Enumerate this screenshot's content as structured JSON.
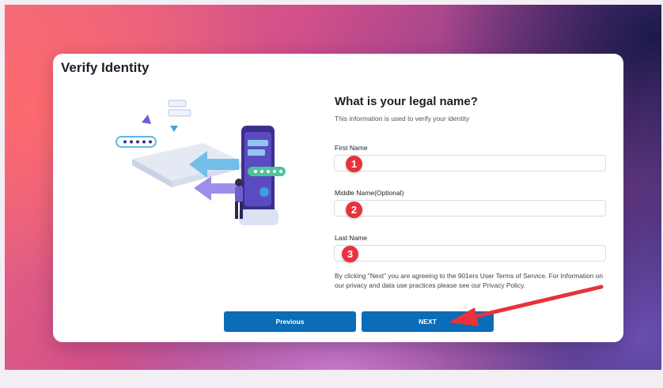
{
  "page": {
    "title": "Verify Identity"
  },
  "form": {
    "heading": "What is your legal name?",
    "subheading": "This information is used to verify your identity",
    "fields": [
      {
        "label": "First Name",
        "value": "",
        "placeholder": "",
        "step": "1"
      },
      {
        "label": "Middle Name(Optional)",
        "value": "",
        "placeholder": "",
        "step": "2"
      },
      {
        "label": "Last Name",
        "value": "",
        "placeholder": "",
        "step": "3"
      }
    ],
    "consent": "By clicking \"Next\" you are agreeing to the 901ers User Terms of Service. For Information on our privacy and data use practices please see our Privacy Policy."
  },
  "buttons": {
    "previous_label": "Previous",
    "next_label": "NEXT"
  },
  "colors": {
    "primary": "#0b6cb8",
    "badge": "#e8323c",
    "arrow": "#e8323c"
  },
  "icons": {
    "illustration": "phone-identity-verification-illustration",
    "annotation": "red-arrow-icon"
  }
}
